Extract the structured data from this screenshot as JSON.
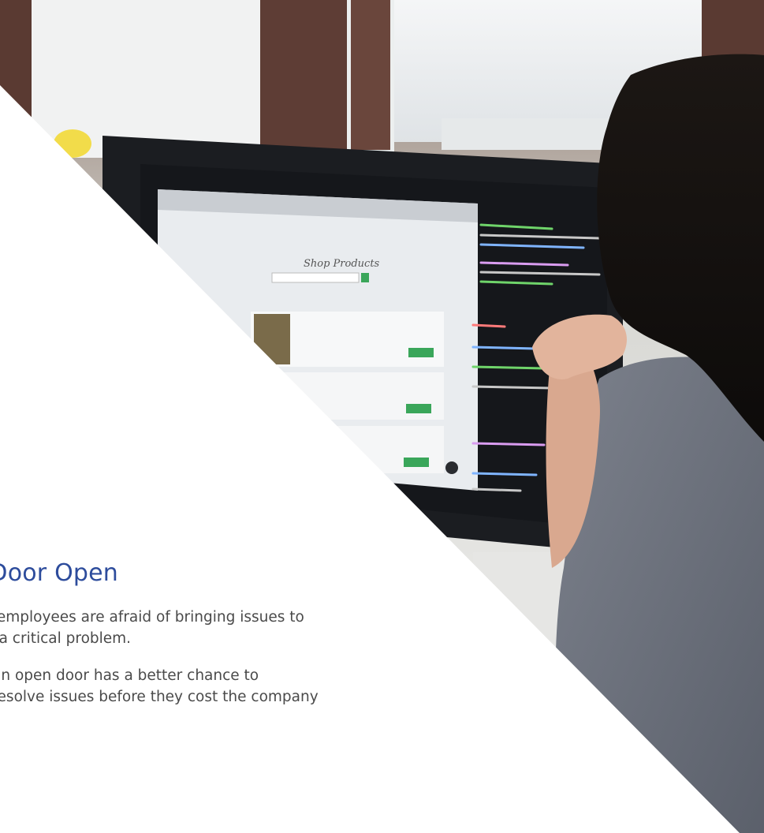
{
  "content": {
    "heading": "e Door Open",
    "paragraph_1_line_1": "ere employees are afraid of bringing issues to",
    "paragraph_1_line_2": "has a critical problem.",
    "paragraph_2_line_1": "ith an open door has a better chance to",
    "paragraph_2_line_2": "nd resolve issues before they cost the company"
  },
  "photo": {
    "subject": "woman-at-computer",
    "screen_heading": "Shop Products",
    "colors": {
      "brick": "#5a3a32",
      "monitor_frame": "#1b1d21",
      "screen_white": "#e9ecef",
      "code_bg": "#121418",
      "shirt": "#6f7480",
      "hair": "#14110f",
      "skin": "#e2b49c",
      "accent_green": "#3aa65a"
    }
  },
  "colors": {
    "heading": "#2d4c9c",
    "body_text": "#4a4a4a",
    "background": "#ffffff"
  }
}
